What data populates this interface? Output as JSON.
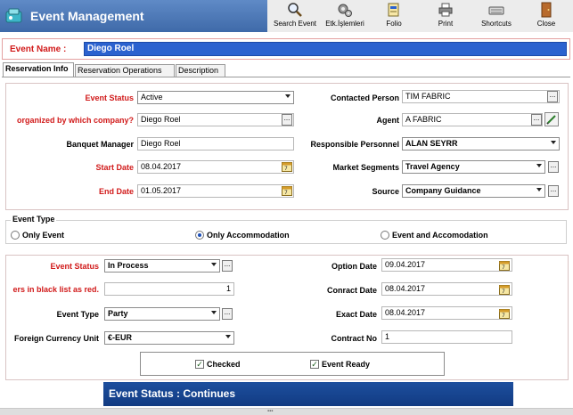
{
  "header": {
    "title": "Event Management"
  },
  "toolbar": {
    "search_event": "Search Event",
    "etk_islemleri": "Etk.İşlemleri",
    "folio": "Folio",
    "print": "Print",
    "shortcuts": "Shortcuts",
    "close": "Close"
  },
  "event_name": {
    "label": "Event Name :",
    "value": "Diego Roel"
  },
  "tabs": [
    "Reservation Info",
    "Reservation Operations",
    "Description"
  ],
  "reservation": {
    "event_status": {
      "label": "Event Status",
      "value": "Active"
    },
    "organized_by": {
      "label": "organized by which company?",
      "value": "Diego Roel"
    },
    "banquet_manager": {
      "label": "Banquet Manager",
      "value": "Diego Roel"
    },
    "start_date": {
      "label": "Start Date",
      "value": "08.04.2017"
    },
    "end_date": {
      "label": "End Date",
      "value": "01.05.2017"
    },
    "contacted_person": {
      "label": "Contacted Person",
      "value": "TIM FABRIC"
    },
    "agent": {
      "label": "Agent",
      "value": "A FABRIC"
    },
    "responsible_personnel": {
      "label": "Responsible Personnel",
      "value": "ALAN  SEYRR"
    },
    "market_segments": {
      "label": "Market Segments",
      "value": "Travel Agency"
    },
    "source": {
      "label": "Source",
      "value": "Company Guidance"
    }
  },
  "event_type": {
    "title": "Event Type",
    "options": [
      "Only Event",
      "Only Accommodation",
      "Event and Accomodation"
    ],
    "selected": "Only Accommodation"
  },
  "status_section": {
    "event_status": {
      "label": "Event Status",
      "value": "In Process"
    },
    "black_list": {
      "label": "ers in black list as red.",
      "value": "1"
    },
    "event_type": {
      "label": "Event Type",
      "value": "Party"
    },
    "currency": {
      "label": "Foreign Currency Unit",
      "value": "€-EUR"
    },
    "option_date": {
      "label": "Option Date",
      "value": "09.04.2017"
    },
    "contract_date": {
      "label": "Conract Date",
      "value": "08.04.2017"
    },
    "exact_date": {
      "label": "Exact Date",
      "value": "08.04.2017"
    },
    "contract_no": {
      "label": "Contract No",
      "value": "1"
    },
    "checked_label": "Checked",
    "event_ready_label": "Event Ready"
  },
  "banner": {
    "text": "Event Status   :   Continues"
  },
  "colors": {
    "header": "#4a76b6",
    "accent_red": "#d11a1a",
    "selection_blue": "#2b62cf",
    "banner": "#1a4994"
  }
}
